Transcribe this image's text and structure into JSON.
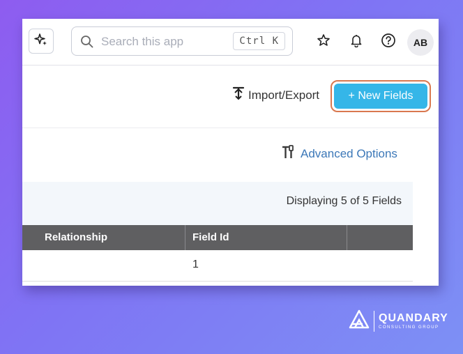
{
  "header": {
    "search_placeholder": "Search this app",
    "search_shortcut": "Ctrl K",
    "avatar_initials": "AB"
  },
  "toolbar": {
    "import_export_label": "Import/Export",
    "new_fields_label": "+ New Fields"
  },
  "options": {
    "advanced_label": "Advanced Options"
  },
  "table": {
    "display_count": "Displaying 5 of 5 Fields",
    "columns": [
      "Relationship",
      "Field Id"
    ],
    "rows": [
      {
        "relationship": "",
        "field_id": "1"
      }
    ]
  },
  "brand": {
    "name": "QUANDARY",
    "tagline": "CONSULTING GROUP"
  },
  "colors": {
    "primary_button": "#35b6e8",
    "highlight_outline": "#d9784f",
    "link": "#3c78b8",
    "table_header": "#5f5f61"
  }
}
